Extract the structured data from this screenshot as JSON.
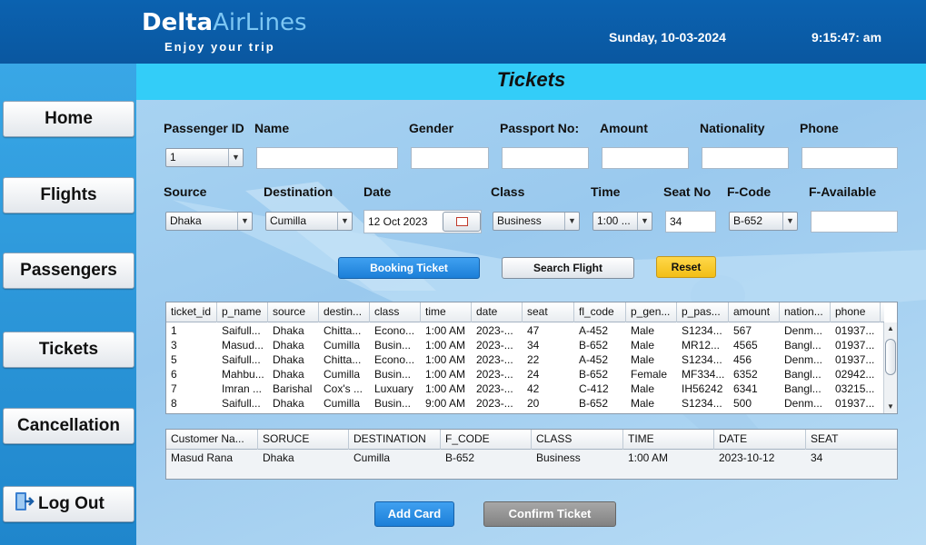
{
  "header": {
    "logo_delta": "Delta",
    "logo_airlines": "AirLines",
    "tagline": "Enjoy your trip",
    "date": "Sunday, 10-03-2024",
    "time": "9:15:47: am"
  },
  "sidebar": {
    "home": "Home",
    "flights": "Flights",
    "passengers": "Passengers",
    "tickets": "Tickets",
    "cancellation": "Cancellation",
    "logout": "Log Out"
  },
  "page": {
    "title": "Tickets"
  },
  "form": {
    "passenger_id_label": "Passenger ID",
    "passenger_id_value": "1",
    "name_label": "Name",
    "name_value": "",
    "gender_label": "Gender",
    "gender_value": "",
    "passport_label": "Passport No:",
    "passport_value": "",
    "amount_label": "Amount",
    "amount_value": "",
    "nationality_label": "Nationality",
    "nationality_value": "",
    "phone_label": "Phone",
    "phone_value": "",
    "source_label": "Source",
    "source_value": "Dhaka",
    "destination_label": "Destination",
    "destination_value": "Cumilla",
    "date_label": "Date",
    "date_value": "12 Oct 2023",
    "class_label": "Class",
    "class_value": "Business",
    "time_label": "Time",
    "time_value": "1:00 ...",
    "seat_label": "Seat No",
    "seat_value": "34",
    "fcode_label": "F-Code",
    "fcode_value": "B-652",
    "favailable_label": "F-Available",
    "favailable_value": ""
  },
  "actions": {
    "booking": "Booking Ticket",
    "search": "Search Flight",
    "reset": "Reset",
    "add_card": "Add Card",
    "confirm": "Confirm Ticket"
  },
  "tickets_table": {
    "columns": [
      "ticket_id",
      "p_name",
      "source",
      "destin...",
      "class",
      "time",
      "date",
      "seat",
      "fl_code",
      "p_gen...",
      "p_pas...",
      "amount",
      "nation...",
      "phone"
    ],
    "rows": [
      [
        "1",
        "Saifull...",
        "Dhaka",
        "Chitta...",
        "Econo...",
        "1:00 AM",
        "2023-...",
        "47",
        "A-452",
        "Male",
        "S1234...",
        "567",
        "Denm...",
        "01937..."
      ],
      [
        "3",
        "Masud...",
        "Dhaka",
        "Cumilla",
        "Busin...",
        "1:00 AM",
        "2023-...",
        "34",
        "B-652",
        "Male",
        "MR12...",
        "4565",
        "Bangl...",
        "01937..."
      ],
      [
        "5",
        "Saifull...",
        "Dhaka",
        "Chitta...",
        "Econo...",
        "1:00 AM",
        "2023-...",
        "22",
        "A-452",
        "Male",
        "S1234...",
        "456",
        "Denm...",
        "01937..."
      ],
      [
        "6",
        "Mahbu...",
        "Dhaka",
        "Cumilla",
        "Busin...",
        "1:00 AM",
        "2023-...",
        "24",
        "B-652",
        "Female",
        "MF334...",
        "6352",
        "Bangl...",
        "02942..."
      ],
      [
        "7",
        "Imran ...",
        "Barishal",
        "Cox's ...",
        "Luxuary",
        "1:00 AM",
        "2023-...",
        "42",
        "C-412",
        "Male",
        "IH56242",
        "6341",
        "Bangl...",
        "03215..."
      ],
      [
        "8",
        "Saifull...",
        "Dhaka",
        "Cumilla",
        "Busin...",
        "9:00 AM",
        "2023-...",
        "20",
        "B-652",
        "Male",
        "S1234...",
        "500",
        "Denm...",
        "01937..."
      ]
    ]
  },
  "card_table": {
    "columns": [
      "Customer Na...",
      "SORUCE",
      "DESTINATION",
      "F_CODE",
      "CLASS",
      "TIME",
      "DATE",
      "SEAT"
    ],
    "rows": [
      [
        "Masud Rana",
        "Dhaka",
        "Cumilla",
        "B-652",
        "Business",
        "1:00 AM",
        "2023-10-12",
        "34"
      ]
    ]
  }
}
